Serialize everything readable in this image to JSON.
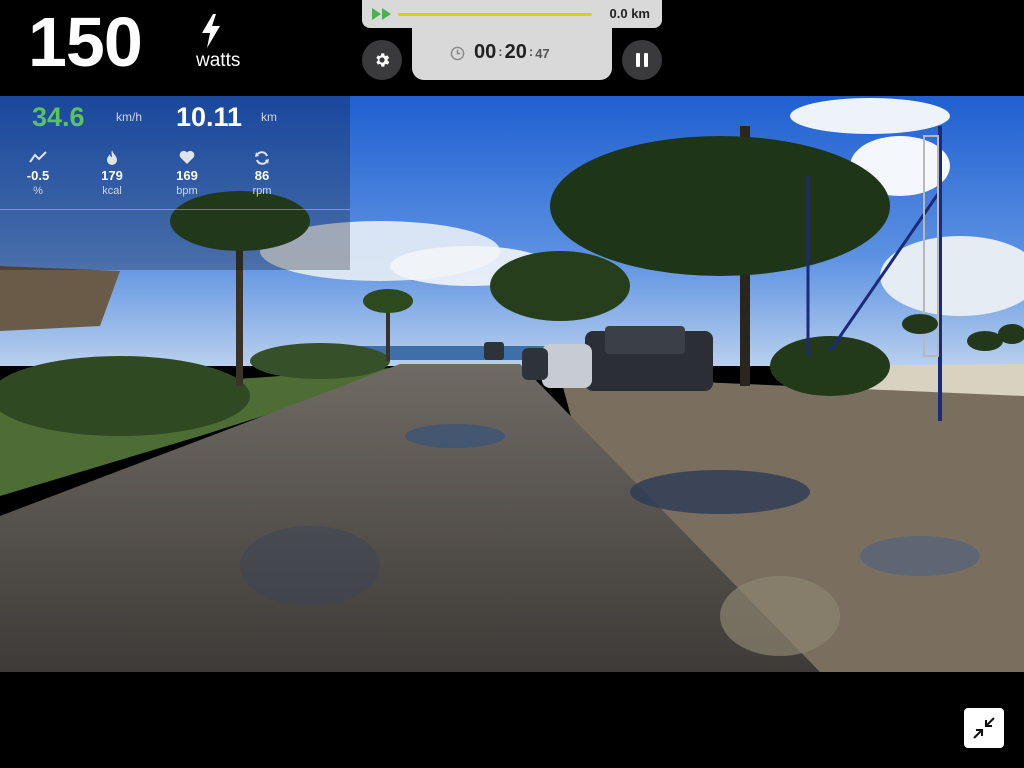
{
  "power": {
    "value": "150",
    "unit": "watts"
  },
  "progress": {
    "distance": "0.0 km",
    "fraction": 0.0
  },
  "timer": {
    "hours": "00",
    "minutes": "20",
    "seconds": "47"
  },
  "stats": {
    "speed": {
      "value": "34.6",
      "unit": "km/h"
    },
    "distance": {
      "value": "10.11",
      "unit": "km"
    },
    "metrics": [
      {
        "name": "grade",
        "icon": "elevation-icon",
        "value": "-0.5",
        "unit": "%"
      },
      {
        "name": "calories",
        "icon": "flame-icon",
        "value": "179",
        "unit": "kcal"
      },
      {
        "name": "heart-rate",
        "icon": "heart-icon",
        "value": "169",
        "unit": "bpm"
      },
      {
        "name": "cadence",
        "icon": "cadence-icon",
        "value": "86",
        "unit": "rpm"
      }
    ]
  },
  "colors": {
    "speed": "#5cc35c",
    "progress": "#f0c41b",
    "fast_forward": "#4caf50"
  }
}
